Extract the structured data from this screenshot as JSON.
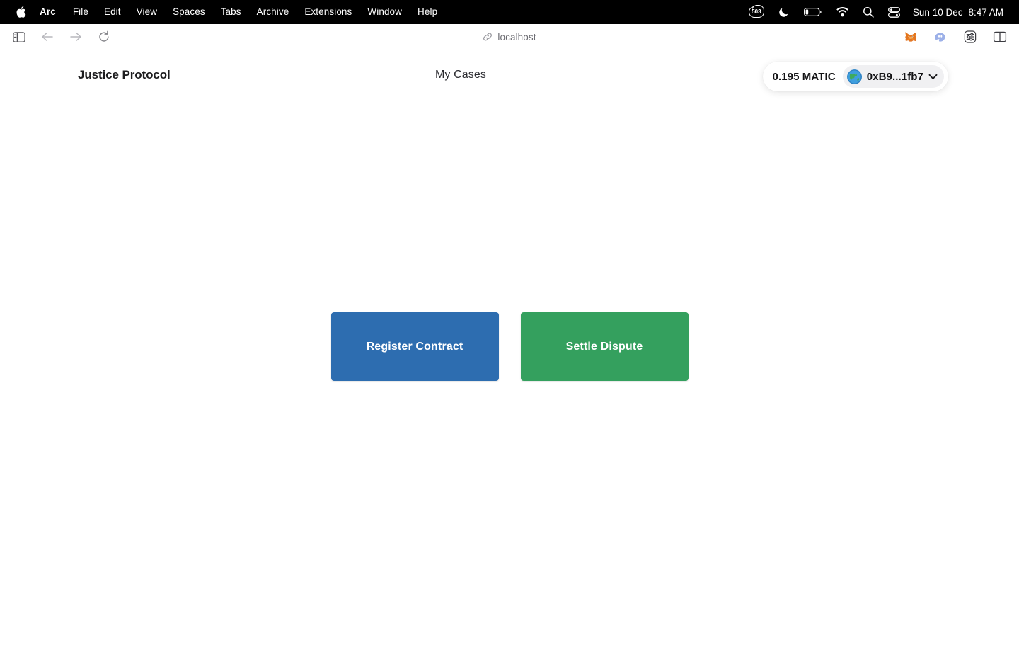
{
  "menubar": {
    "apple_icon": "apple-logo",
    "items": [
      {
        "label": "Arc",
        "bold": true
      },
      {
        "label": "File"
      },
      {
        "label": "Edit"
      },
      {
        "label": "View"
      },
      {
        "label": "Spaces"
      },
      {
        "label": "Tabs"
      },
      {
        "label": "Archive"
      },
      {
        "label": "Extensions"
      },
      {
        "label": "Window"
      },
      {
        "label": "Help"
      }
    ],
    "status": {
      "badge_count": "503",
      "badge_icon": "stats-badge-icon",
      "dnd_icon": "moon-icon",
      "battery_icon": "battery-icon",
      "wifi_icon": "wifi-icon",
      "search_icon": "search-icon",
      "control_center_icon": "control-center-icon",
      "date": "Sun 10 Dec",
      "time": "8:47 AM"
    }
  },
  "browser": {
    "sidebar_toggle_icon": "sidebar-toggle-icon",
    "back_icon": "arrow-left-icon",
    "forward_icon": "arrow-right-icon",
    "reload_icon": "reload-icon",
    "url_icon": "link-icon",
    "url": "localhost",
    "extensions": [
      {
        "name": "metamask-extension-icon"
      },
      {
        "name": "phantom-extension-icon"
      },
      {
        "name": "settings-sliders-icon"
      },
      {
        "name": "split-view-icon"
      }
    ]
  },
  "app": {
    "brand": "Justice Protocol",
    "nav": {
      "my_cases": "My Cases"
    },
    "wallet": {
      "balance": "0.195 MATIC",
      "avatar_icon": "globe-icon",
      "address": "0xB9...1fb7",
      "chevron_icon": "chevron-down-icon"
    },
    "actions": [
      {
        "label": "Register Contract",
        "color": "#2d6db0"
      },
      {
        "label": "Settle Dispute",
        "color": "#34a05e"
      }
    ]
  }
}
